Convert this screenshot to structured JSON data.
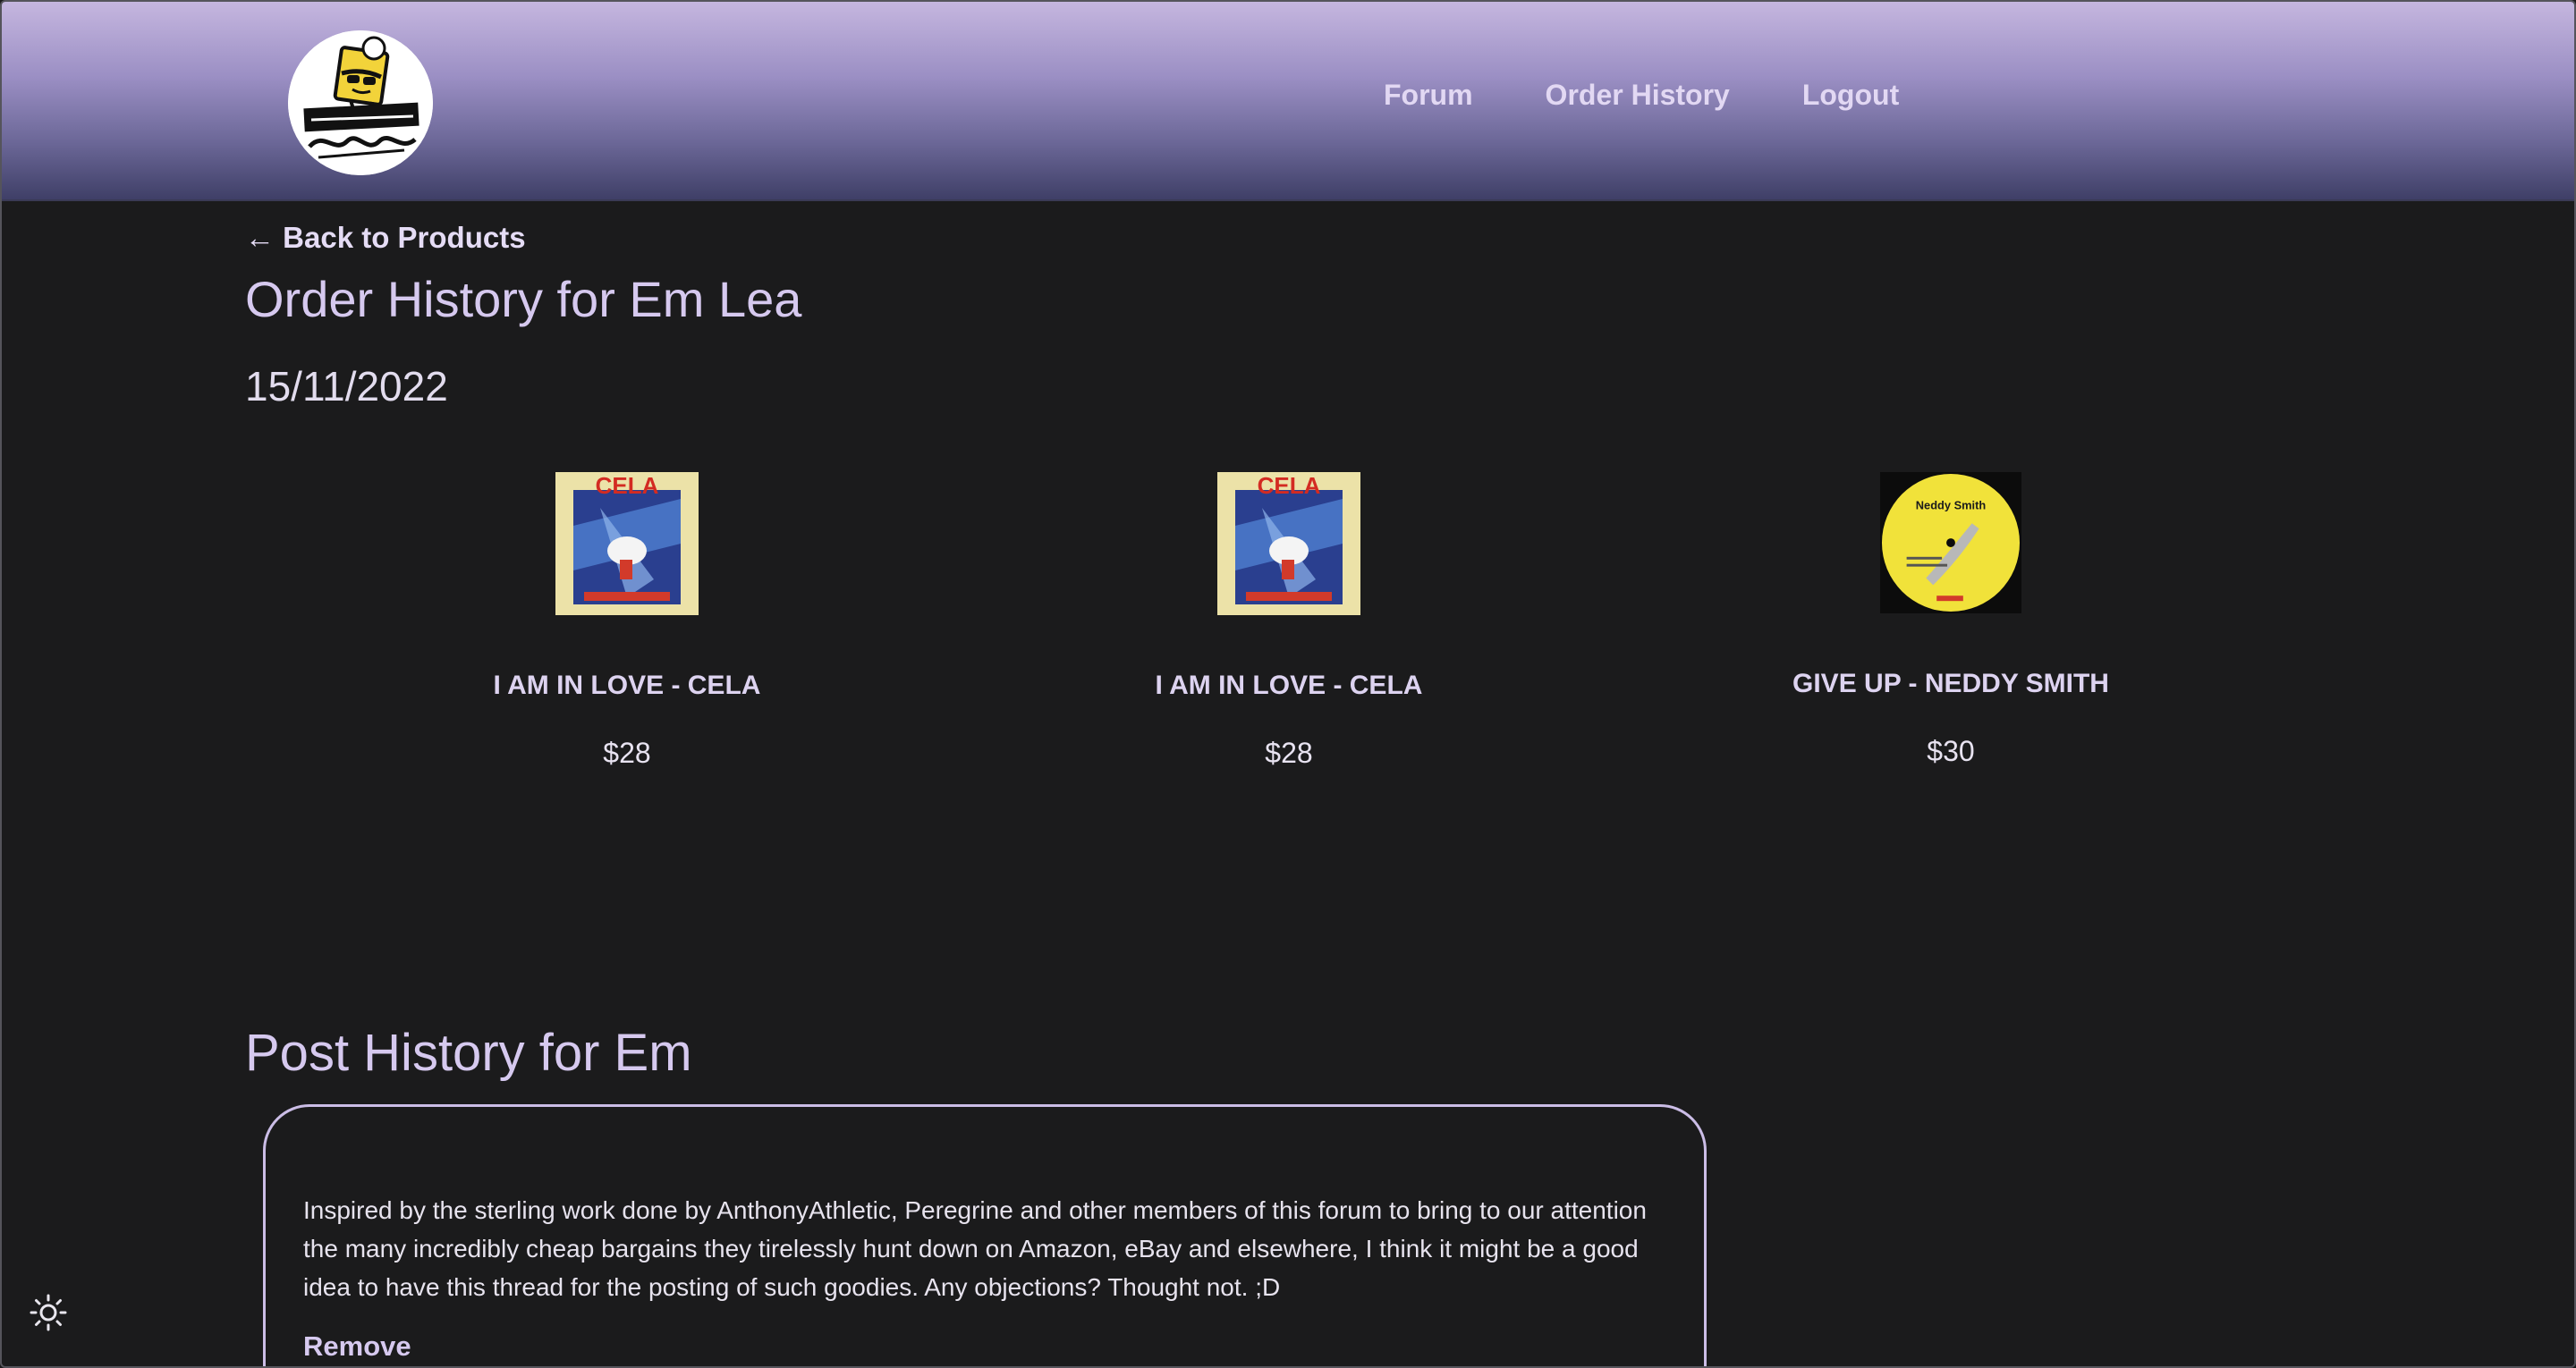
{
  "header": {
    "logo_alt": "Record Playerz",
    "nav": {
      "forum": "Forum",
      "order_history": "Order History",
      "logout": "Logout"
    }
  },
  "main": {
    "back_link": "← Back to Products",
    "title": "Order History for Em Lea",
    "orders": [
      {
        "date": "15/11/2022",
        "items": [
          {
            "name": "I AM IN LOVE - CELA",
            "price": "$28",
            "cover_icon": "cela-album-cover"
          },
          {
            "name": "I AM IN LOVE - CELA",
            "price": "$28",
            "cover_icon": "cela-album-cover"
          },
          {
            "name": "GIVE UP - NEDDY SMITH",
            "price": "$30",
            "cover_icon": "neddy-smith-record-label"
          }
        ]
      }
    ]
  },
  "posts": {
    "title": "Post History for Em",
    "items": [
      {
        "text": "Inspired by the sterling work done by AnthonyAthletic, Peregrine and other members of this forum to bring to our attention the many incredibly cheap bargains they tirelessly hunt down on Amazon, eBay and elsewhere, I think it might be a good idea to have this thread for the posting of such goodies. Any objections? Thought not. ;D",
        "remove_label": "Remove"
      }
    ]
  },
  "theme_toggle_icon": "sun-icon",
  "colors": {
    "background": "#1b1b1c",
    "accent": "#cdbfe8",
    "header_top": "#c5b6df",
    "header_bottom": "#3f3f67"
  }
}
